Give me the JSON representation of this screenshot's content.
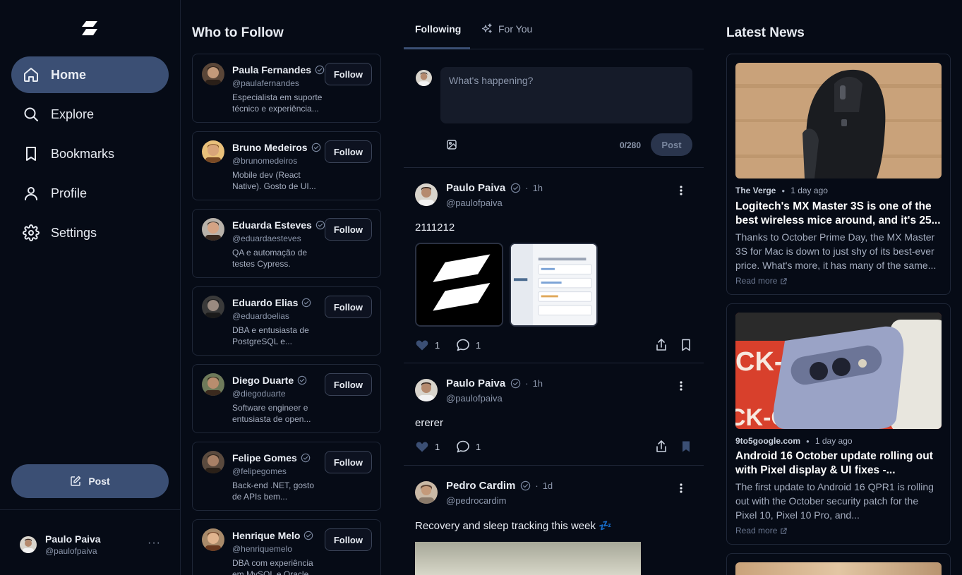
{
  "sidebar": {
    "nav": [
      {
        "label": "Home",
        "icon": "home-icon",
        "active": true
      },
      {
        "label": "Explore",
        "icon": "search-icon"
      },
      {
        "label": "Bookmarks",
        "icon": "bookmark-icon"
      },
      {
        "label": "Profile",
        "icon": "user-icon"
      },
      {
        "label": "Settings",
        "icon": "gear-icon"
      }
    ],
    "post_label": "Post",
    "account": {
      "name": "Paulo Paiva",
      "handle": "@paulofpaiva",
      "more": "···"
    }
  },
  "who_to_follow": {
    "title": "Who to Follow",
    "follow_label": "Follow",
    "users": [
      {
        "name": "Paula Fernandes",
        "handle": "@paulafernandes",
        "bio1": "Especialista em suporte",
        "bio2": "técnico e experiência..."
      },
      {
        "name": "Bruno Medeiros",
        "handle": "@brunomedeiros",
        "bio1": "Mobile dev (React",
        "bio2": "Native). Gosto de UI..."
      },
      {
        "name": "Eduarda Esteves",
        "handle": "@eduardaesteves",
        "bio1": "QA e automação de",
        "bio2": "testes Cypress."
      },
      {
        "name": "Eduardo Elias",
        "handle": "@eduardoelias",
        "bio1": "DBA e entusiasta de",
        "bio2": "PostgreSQL e..."
      },
      {
        "name": "Diego Duarte",
        "handle": "@diegoduarte",
        "bio1": "Software engineer e",
        "bio2": "entusiasta de open..."
      },
      {
        "name": "Felipe Gomes",
        "handle": "@felipegomes",
        "bio1": "Back-end .NET, gosto",
        "bio2": "de APIs bem..."
      },
      {
        "name": "Henrique Melo",
        "handle": "@henriquemelo",
        "bio1": "DBA com experiência",
        "bio2": "em MySQL e Oracle..."
      }
    ]
  },
  "feed": {
    "tabs": [
      {
        "label": "Following",
        "active": true
      },
      {
        "label": "For You"
      }
    ],
    "composer": {
      "placeholder": "What's happening?",
      "count": "0/280",
      "post_label": "Post"
    },
    "posts": [
      {
        "name": "Paulo Paiva",
        "handle": "@paulofpaiva",
        "time": "1h",
        "text": "2111212",
        "likes": "1",
        "comments": "1"
      },
      {
        "name": "Paulo Paiva",
        "handle": "@paulofpaiva",
        "time": "1h",
        "text": "ererer",
        "likes": "1",
        "comments": "1"
      },
      {
        "name": "Pedro Cardim",
        "handle": "@pedrocardim",
        "time": "1d",
        "text": "Recovery and sleep tracking this week 💤"
      }
    ]
  },
  "news": {
    "title": "Latest News",
    "read_more": "Read more",
    "items": [
      {
        "source": "The Verge",
        "age": "1 day ago",
        "headline1": "Logitech's MX Master 3S is one of the",
        "headline2": "best wireless mice around, and it's 25...",
        "desc1": "Thanks to October Prime Day, the MX Master",
        "desc2": "3S for Mac is down to just shy of its best-ever",
        "desc3": "price. What's more, it has many of the same..."
      },
      {
        "source": "9to5google.com",
        "age": "1 day ago",
        "headline1": "Android 16 October update rolling out",
        "headline2": "with Pixel display & UI fixes -...",
        "desc1": "The first update to Android 16 QPR1 is rolling",
        "desc2": "out with the October security patch for the",
        "desc3": "Pixel 10, Pixel 10 Pro, and..."
      }
    ]
  },
  "colors": {
    "background": "#060b16",
    "accent": "#3b4f74",
    "border": "#1f2738",
    "muted": "#8b96ab"
  }
}
